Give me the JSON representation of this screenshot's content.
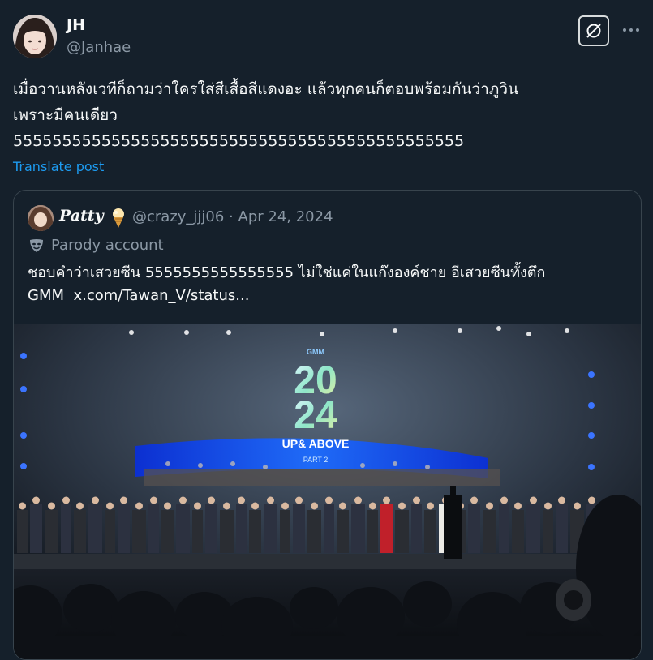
{
  "author": {
    "name": "JH",
    "handle": "@Janhae"
  },
  "tweet": {
    "text_line1": "เมื่อวานหลังเวทีก็ถามว่าใครใส่สีเสื้อสีแดงอะ แล้วทุกคนก็ตอบพร้อมกันว่าภูวิน",
    "text_line2": "เพราะมีคนเดียว",
    "text_line3": "5555555555555555555555555555555555555555555555",
    "translate_label": "Translate post"
  },
  "quote": {
    "name": "Patty",
    "handle_date": "@crazy_jjj06 · Apr 24, 2024",
    "parody_label": "Parody account",
    "text": "ชอบคำว่าเสวยซีน 5555555555555555 ไม่ใช่แค่ในแก๊งองค์ชาย อีเสวยซีนทั้งตึก",
    "text_line2_prefix": "GMM",
    "link": "x.com/Tawan_V/status..."
  },
  "media": {
    "logo_badge": "GMM",
    "logo_year_top": "20",
    "logo_year_bottom": "24",
    "logo_title": "UP& ABOVE",
    "logo_part": "PART 2"
  },
  "colors": {
    "background": "#15202b",
    "text": "#f7f9f9",
    "secondary": "#8b98a5",
    "link": "#1d9bf0",
    "border": "#38444d"
  },
  "icons": {
    "grok": "grok-icon",
    "more": "more-icon",
    "parody": "parody-mask-icon",
    "emoji": "ice-cream-icon"
  }
}
